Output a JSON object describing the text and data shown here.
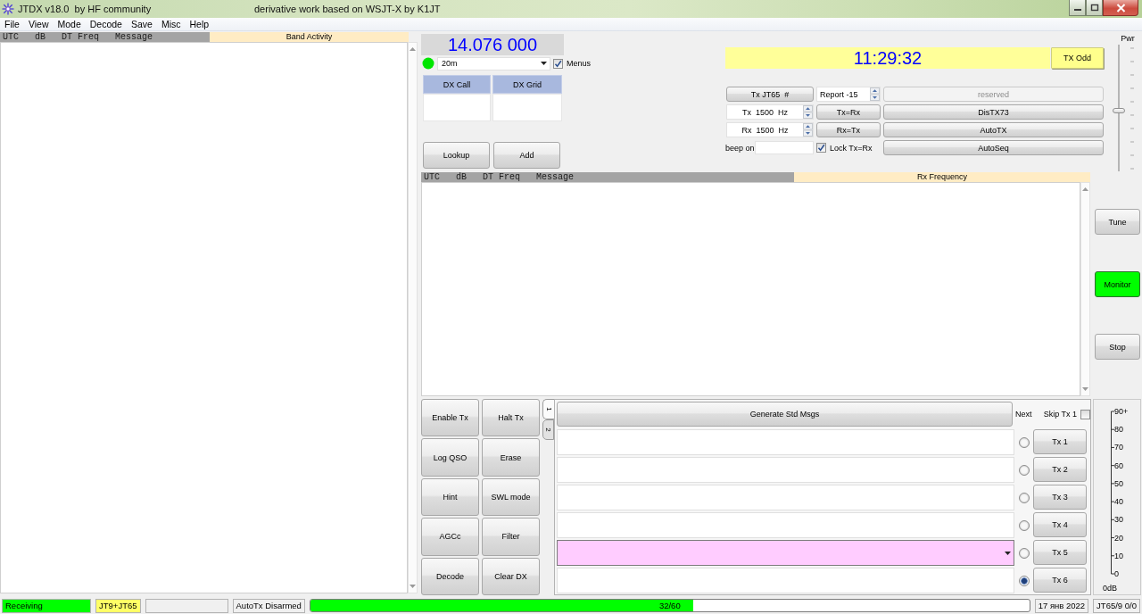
{
  "window": {
    "title": "JTDX v18.0  by HF community",
    "subtitle": "derivative work based on WSJT-X by K1JT"
  },
  "menu": [
    "File",
    "View",
    "Mode",
    "Decode",
    "Save",
    "Misc",
    "Help"
  ],
  "band_activity": {
    "header": "UTC   dB   DT Freq   Message",
    "title": "Band Activity"
  },
  "rig": {
    "frequency": "14.076 000",
    "band": "20m",
    "menus": {
      "label": "Menus",
      "checked": true
    }
  },
  "dx": {
    "columns": [
      "DX Call",
      "DX Grid"
    ],
    "buttons": [
      "Lookup",
      "Add"
    ]
  },
  "clock": {
    "time": "11:29:32",
    "period_button": "TX Odd"
  },
  "tx_panel": {
    "mode_button": "Tx JT65  #",
    "report": "Report -15",
    "tx_frequency": "Tx  1500  Hz",
    "rx_frequency": "Rx  1500  Hz",
    "copy_buttons": [
      "Tx=Rx",
      "Rx=Tx"
    ],
    "beep_label": "beep on",
    "lock": {
      "label": "Lock Tx=Rx",
      "checked": true
    },
    "option_buttons": [
      {
        "label": "reserved",
        "disabled": true
      },
      {
        "label": "DisTX73",
        "disabled": false
      },
      {
        "label": "AutoTX",
        "disabled": false
      },
      {
        "label": "AutoSeq",
        "disabled": false
      }
    ]
  },
  "power": {
    "label": "Pwr",
    "level": 0.48
  },
  "rx_frequency": {
    "header": "UTC   dB   DT Freq   Message",
    "title": "Rx Frequency"
  },
  "side_buttons": [
    {
      "label": "Tune",
      "on": false
    },
    {
      "label": "Monitor",
      "on": true
    },
    {
      "label": "Stop",
      "on": false
    }
  ],
  "action_buttons": [
    "Enable Tx",
    "Halt Tx",
    "Log QSO",
    "Erase",
    "Hint",
    "SWL mode",
    "AGCc",
    "Filter",
    "Decode",
    "Clear DX"
  ],
  "message_tabs": [
    {
      "label": "1",
      "selected": true
    },
    {
      "label": "2",
      "selected": false
    }
  ],
  "messages_panel": {
    "generate_button": "Generate Std Msgs",
    "next_label": "Next",
    "skip_tx1": {
      "label": "Skip Tx 1",
      "checked": false
    },
    "rows": [
      {
        "kind": "field",
        "selected": false,
        "button": "Tx 1"
      },
      {
        "kind": "field",
        "selected": false,
        "button": "Tx 2"
      },
      {
        "kind": "field",
        "selected": false,
        "button": "Tx 3"
      },
      {
        "kind": "field",
        "selected": false,
        "button": "Tx 4"
      },
      {
        "kind": "combo",
        "selected": false,
        "button": "Tx 5"
      },
      {
        "kind": "field",
        "selected": true,
        "button": "Tx 6"
      }
    ]
  },
  "meter": {
    "ticks": [
      "90+",
      "80",
      "70",
      "60",
      "50",
      "40",
      "30",
      "20",
      "10",
      "0"
    ],
    "unit": "0dB"
  },
  "status_bar": {
    "state": "Receiving",
    "modes": "JT9+JT65",
    "autotx": "AutoTx Disarmed",
    "progress": {
      "level": 0.533,
      "text": "32/60"
    },
    "date": "17 янв 2022",
    "mode_info": "JT65/9 0/0"
  }
}
